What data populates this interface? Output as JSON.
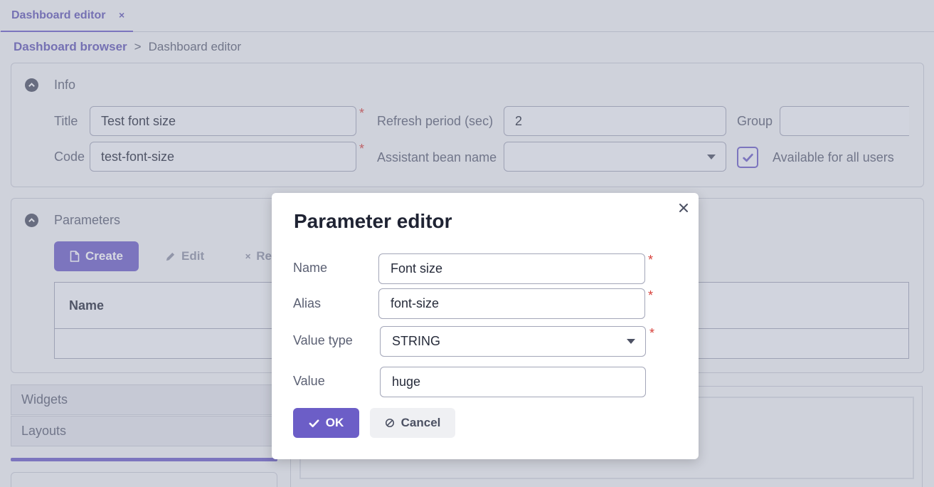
{
  "tabs": [
    {
      "label": "Dashboard editor",
      "close": "×"
    }
  ],
  "breadcrumb": {
    "parent": "Dashboard browser",
    "separator": ">",
    "current": "Dashboard editor"
  },
  "info": {
    "title": "Info",
    "title_label": "Title",
    "title_value": "Test font size",
    "code_label": "Code",
    "code_value": "test-font-size",
    "refresh_label": "Refresh period (sec)",
    "refresh_value": "2",
    "assistant_label": "Assistant bean name",
    "assistant_value": "",
    "group_label": "Group",
    "group_value": "",
    "available_label": "Available for all users",
    "available_checked": true,
    "required_mark": "*"
  },
  "parameters": {
    "title": "Parameters",
    "create_label": "Create",
    "edit_label": "Edit",
    "remove_label": "Re",
    "columns": [
      "Name"
    ]
  },
  "accordion": [
    {
      "label": "Widgets"
    },
    {
      "label": "Layouts"
    }
  ],
  "modal": {
    "title": "Parameter editor",
    "required_mark": "*",
    "name_label": "Name",
    "name_value": "Font size",
    "alias_label": "Alias",
    "alias_value": "font-size",
    "type_label": "Value type",
    "type_value": "STRING",
    "value_label": "Value",
    "value_value": "huge",
    "ok_label": "OK",
    "cancel_label": "Cancel"
  },
  "colors": {
    "accent": "#6c5ec7",
    "required": "#d7403a"
  }
}
